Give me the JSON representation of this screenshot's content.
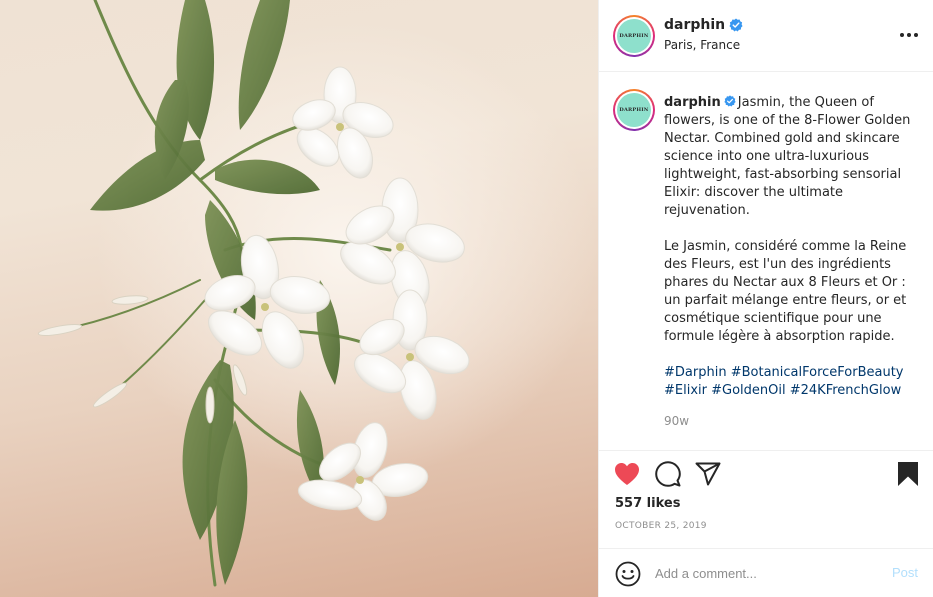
{
  "post": {
    "image_alt": "",
    "author": {
      "username": "darphin",
      "verified": true,
      "avatar_text": "DARPHIN",
      "location": "Paris, France"
    },
    "caption": {
      "english": "Jasmin, the Queen of flowers, is one of the 8-Flower Golden Nectar. Combined gold and skincare science into one ultra-luxurious lightweight, fast-absorbing sensorial Elixir: discover the ultimate rejuvenation.",
      "french": "Le Jasmin, considéré comme la Reine des Fleurs, est l'un des ingrédients phares du Nectar aux 8 Fleurs et Or : un parfait mélange entre fleurs, or et cosmétique scientifique pour une formule légère à absorption rapide.",
      "hashtags": [
        "#Darphin",
        "#BotanicalForceForBeauty",
        "#Elixir",
        "#GoldenOil",
        "#24KFrenchGlow"
      ]
    },
    "age": "90w",
    "likes": "557 likes",
    "date": "OCTOBER 25, 2019",
    "liked": true
  },
  "comment": {
    "placeholder": "Add a comment...",
    "post_label": "Post"
  },
  "colors": {
    "like_red": "#ed4956",
    "verified_blue": "#3897f0",
    "hashtag_blue": "#00376b",
    "post_disabled": "#b2dffc",
    "avatar_mint": "#8ee0cc"
  },
  "icons": {
    "more": "more-horizontal-icon",
    "like": "heart-filled-icon",
    "comment": "speech-bubble-icon",
    "share": "paper-plane-icon",
    "save": "bookmark-filled-icon",
    "emoji": "smiley-icon",
    "verified": "verified-badge-icon"
  }
}
